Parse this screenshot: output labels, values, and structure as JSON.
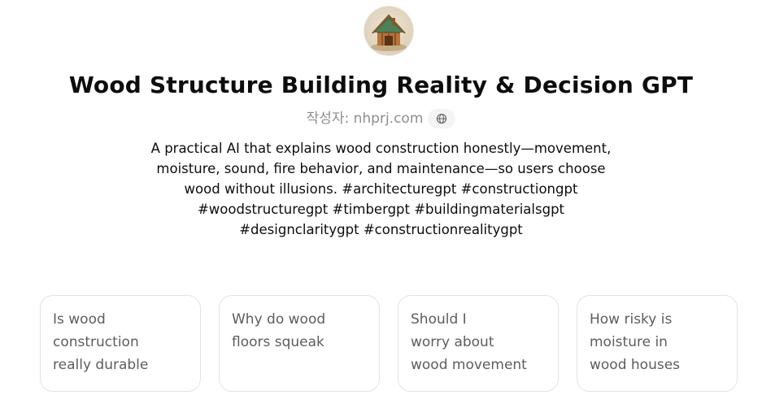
{
  "gpt": {
    "title": "Wood Structure Building Reality & Decision GPT",
    "author": "작성자: nhprj.com",
    "description": "A practical AI that explains wood construction honestly—movement, moisture, sound, fire behavior, and maintenance—so users choose wood without illusions. #architecturegpt #constructiongpt #woodstructuregpt #timbergpt #buildingmaterialsgpt #designclaritygpt #constructionrealitygpt",
    "avatar_icon": "wooden-house-icon",
    "website_icon": "globe-icon"
  },
  "conversation_starters": [
    {
      "label": "Is wood\nconstruction\nreally durable"
    },
    {
      "label": "Why do wood\nfloors squeak"
    },
    {
      "label": "Should I\nworry about\nwood movement"
    },
    {
      "label": "How risky is\nmoisture in\nwood houses"
    }
  ],
  "colors": {
    "text_primary": "#0d0d0d",
    "text_muted": "#8e8e8e",
    "card_border": "#e3e3e3",
    "chip_bg": "#f4f4f4"
  }
}
